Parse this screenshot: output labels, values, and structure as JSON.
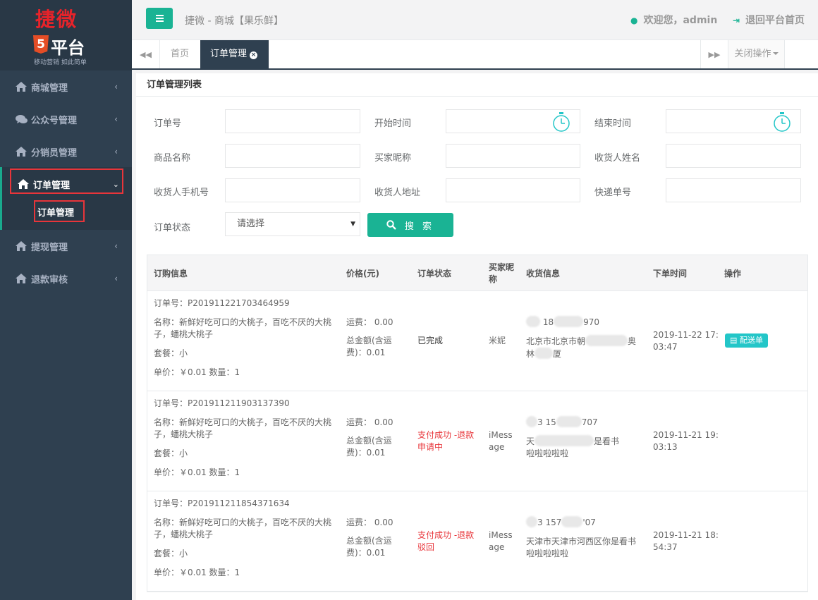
{
  "logo": {
    "title": "捷微",
    "badge": "5",
    "name": "平台",
    "slogan": "移动营销 如此简单"
  },
  "sidebar": {
    "items": [
      {
        "label": "商城管理"
      },
      {
        "label": "公众号管理"
      },
      {
        "label": "分销员管理"
      },
      {
        "label": "订单管理"
      },
      {
        "label": "提现管理"
      },
      {
        "label": "退款审核"
      }
    ],
    "sub_item": "订单管理"
  },
  "header": {
    "title": "捷微 - 商城【果乐鲜】",
    "welcome": "欢迎您，admin",
    "back": "退回平台首页"
  },
  "tabs": {
    "home": "首页",
    "active": "订单管理",
    "close_ops": "关闭操作"
  },
  "panel": {
    "title": "订单管理列表"
  },
  "filters": {
    "order_no": "订单号",
    "start_time": "开始时间",
    "end_time": "结束时间",
    "product_name": "商品名称",
    "buyer_nick": "买家昵称",
    "receiver_name": "收货人姓名",
    "receiver_phone": "收货人手机号",
    "receiver_addr": "收货人地址",
    "express_no": "快递单号",
    "status": "订单状态",
    "status_value": "请选择",
    "search": "搜 索"
  },
  "table": {
    "headers": {
      "order_info": "订购信息",
      "price": "价格(元)",
      "status": "订单状态",
      "buyer_nick_1": "买家昵",
      "buyer_nick_2": "称",
      "receive_info": "收货信息",
      "order_time": "下单时间",
      "ops": "操作"
    },
    "rows": [
      {
        "order_no": "订单号：P201911221703464959",
        "name_1": "名称：新鲜好吃可口的大桃子，百吃不厌的大桃",
        "name_2": "子，蟠桃大桃子",
        "package": "套餐：小",
        "unit": "单价：￥0.01 数量：1",
        "freight": "运费： 0.00",
        "total_1": "总金额(含运",
        "total_2": "费)：0.01",
        "status_1": "已完成",
        "status_2": "",
        "nick_1": "米妮",
        "nick_2": "",
        "phone_a": "18",
        "phone_b": "970",
        "addr_1": "北京市北京市朝",
        "addr_1b": "奥",
        "addr_2": "林",
        "addr_2b": "厦",
        "time_1": "2019-11-22 17:",
        "time_2": "03:47",
        "op": "配送单"
      },
      {
        "order_no": "订单号：P201911211903137390",
        "name_1": "名称：新鲜好吃可口的大桃子，百吃不厌的大桃",
        "name_2": "子，蟠桃大桃子",
        "package": "套餐：小",
        "unit": "单价：￥0.01 数量：1",
        "freight": "运费： 0.00",
        "total_1": "总金额(含运",
        "total_2": "费)：0.01",
        "status_1": "支付成功 -退款",
        "status_2": "申请中",
        "nick_1": "iMess",
        "nick_2": "age",
        "phone_a": "3 15",
        "phone_b": "707",
        "addr_1": "天",
        "addr_1b": "是看书",
        "addr_2": "啦啦啦啦啦",
        "addr_2b": "",
        "time_1": "2019-11-21 19:",
        "time_2": "03:13",
        "op": ""
      },
      {
        "order_no": "订单号：P201911211854371634",
        "name_1": "名称：新鲜好吃可口的大桃子，百吃不厌的大桃",
        "name_2": "子，蟠桃大桃子",
        "package": "套餐：小",
        "unit": "单价：￥0.01 数量：1",
        "freight": "运费： 0.00",
        "total_1": "总金额(含运",
        "total_2": "费)：0.01",
        "status_1": "支付成功 -退款",
        "status_2": "驳回",
        "nick_1": "iMess",
        "nick_2": "age",
        "phone_a": "3 157",
        "phone_b": "'07",
        "addr_1": "天津市天津市河西区你是看书",
        "addr_1b": "",
        "addr_2": "啦啦啦啦啦",
        "addr_2b": "",
        "time_1": "2019-11-21 18:",
        "time_2": "54:37",
        "op": ""
      }
    ]
  },
  "colors": {
    "sidebar": "#2f4050",
    "accent": "#1ab394",
    "info": "#23c6c8",
    "danger": "#e8353a"
  }
}
